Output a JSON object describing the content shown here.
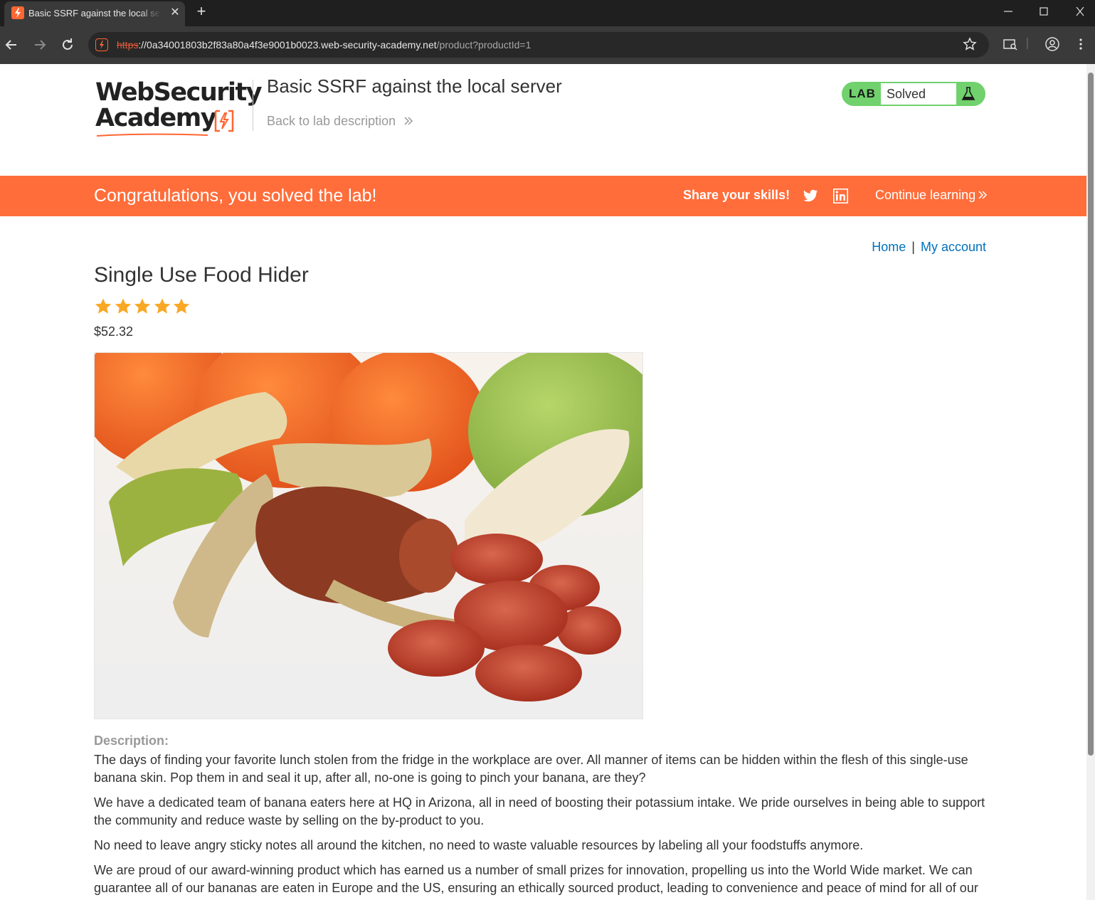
{
  "browser": {
    "tab_title": "Basic SSRF against the local server",
    "tab_close": "✕",
    "new_tab": "+",
    "url_scheme": "https",
    "url_host": "://0a34001803b2f83a80a4f3e9001b0023.web-security-academy.net",
    "url_path": "/product?productId=1"
  },
  "header": {
    "logo_line1": "WebSecurity",
    "logo_line2": "Academy",
    "lab_title": "Basic SSRF against the local server",
    "back_link": "Back to lab description",
    "lab_label": "LAB",
    "lab_status": "Solved"
  },
  "banner": {
    "message": "Congratulations, you solved the lab!",
    "share": "Share your skills!",
    "continue": "Continue learning"
  },
  "nav": {
    "home": "Home",
    "separator": "|",
    "account": "My account"
  },
  "product": {
    "title": "Single Use Food Hider",
    "rating": 5,
    "price": "$52.32",
    "description_label": "Description:",
    "description": [
      "The days of finding your favorite lunch stolen from the fridge in the workplace are over. All manner of items can be hidden within the flesh of this single-use banana skin. Pop them in and seal it up, after all, no-one is going to pinch your banana, are they?",
      "We have a dedicated team of banana eaters here at HQ in Arizona, all in need of boosting their potassium intake. We pride ourselves in being able to support the community and reduce waste by selling on the by-product to you.",
      "No need to leave angry sticky notes all around the kitchen, no need to waste valuable resources by labeling all your foodstuffs anymore.",
      "We are proud of our award-winning product which has earned us a number of small prizes for innovation, propelling us into the World Wide market. We can guarantee all of our bananas are eaten in Europe and the US, ensuring an ethically sourced product, leading to convenience and peace of mind for all of our"
    ]
  },
  "colors": {
    "brand_orange": "#ff6d3a",
    "lab_green": "#70d16d",
    "link_blue": "#0071bc",
    "star_gold": "#f9a825"
  }
}
